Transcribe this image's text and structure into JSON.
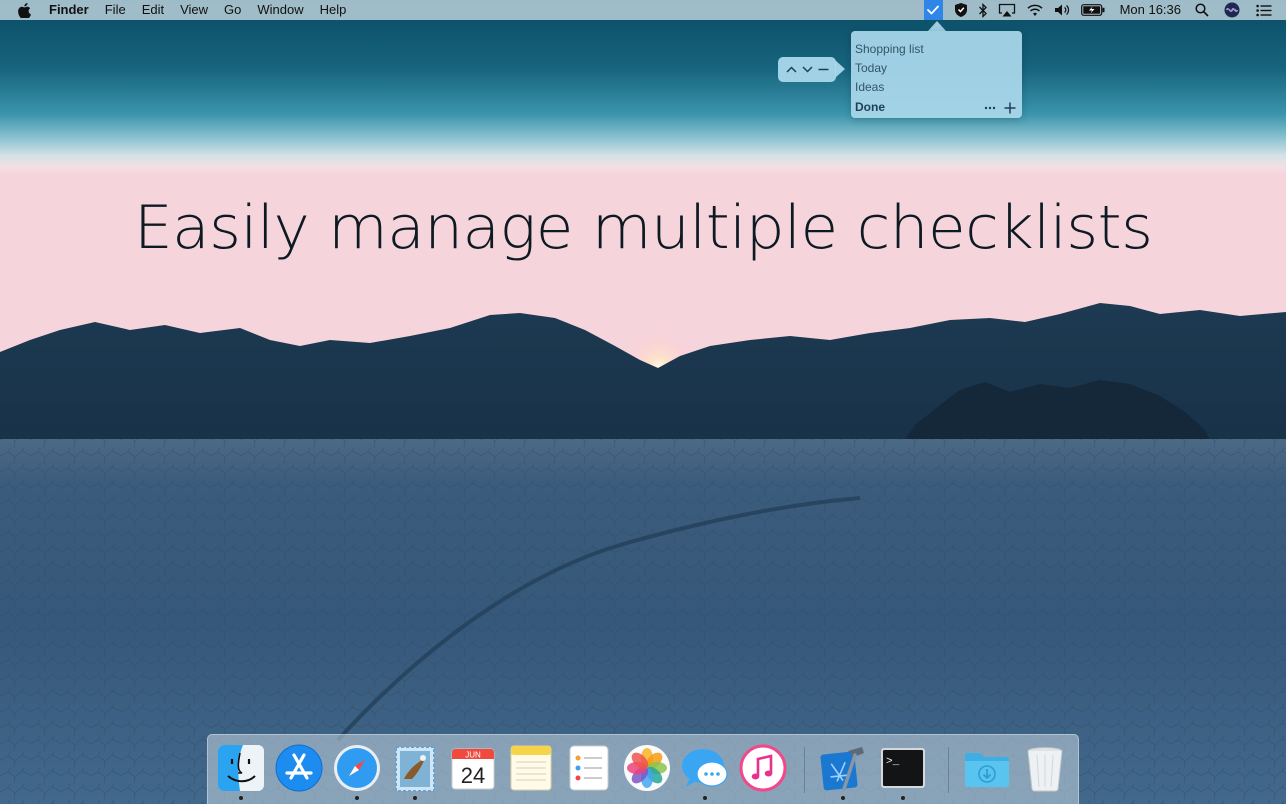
{
  "menubar": {
    "app_name": "Finder",
    "menus": [
      "File",
      "Edit",
      "View",
      "Go",
      "Window",
      "Help"
    ],
    "status_icons": [
      "checklist-icon",
      "shield-icon",
      "bluetooth-icon",
      "airplay-icon",
      "wifi-icon",
      "volume-icon",
      "battery-icon"
    ],
    "clock": "Mon 16:36",
    "right_icons": [
      "spotlight-icon",
      "siri-icon",
      "notification-center-icon"
    ]
  },
  "popover": {
    "items": [
      {
        "label": "Shopping list",
        "selected": false
      },
      {
        "label": "Today",
        "selected": false
      },
      {
        "label": "Ideas",
        "selected": false
      },
      {
        "label": "Done",
        "selected": true
      }
    ],
    "actions": [
      "more-icon",
      "plus-icon"
    ],
    "toolbar_buttons": [
      "chevron-up-icon",
      "chevron-down-icon",
      "minus-icon"
    ]
  },
  "headline": "Easily manage multiple checklists",
  "calendar_icon": {
    "month": "JUN",
    "day": "24"
  },
  "terminal_icon": {
    "prompt": ">_"
  },
  "dock": {
    "apps": [
      {
        "name": "finder-icon",
        "running": true
      },
      {
        "name": "app-store-icon",
        "running": false
      },
      {
        "name": "safari-icon",
        "running": true
      },
      {
        "name": "mail-icon",
        "running": true
      },
      {
        "name": "calendar-icon",
        "running": false
      },
      {
        "name": "notes-icon",
        "running": false
      },
      {
        "name": "reminders-icon",
        "running": false
      },
      {
        "name": "photos-icon",
        "running": false
      },
      {
        "name": "messages-icon",
        "running": true
      },
      {
        "name": "itunes-icon",
        "running": false
      },
      {
        "name": "xcode-icon",
        "running": true
      },
      {
        "name": "terminal-icon",
        "running": true
      },
      {
        "name": "downloads-folder-icon",
        "running": false
      },
      {
        "name": "trash-icon",
        "running": false
      }
    ]
  },
  "colors": {
    "menubar_bg": "#d8e8ee",
    "checklist_accent": "#2f86e6",
    "popover_bg": "#aad8ec",
    "popover_text": "#355468",
    "headline_text": "#0d1a22"
  }
}
